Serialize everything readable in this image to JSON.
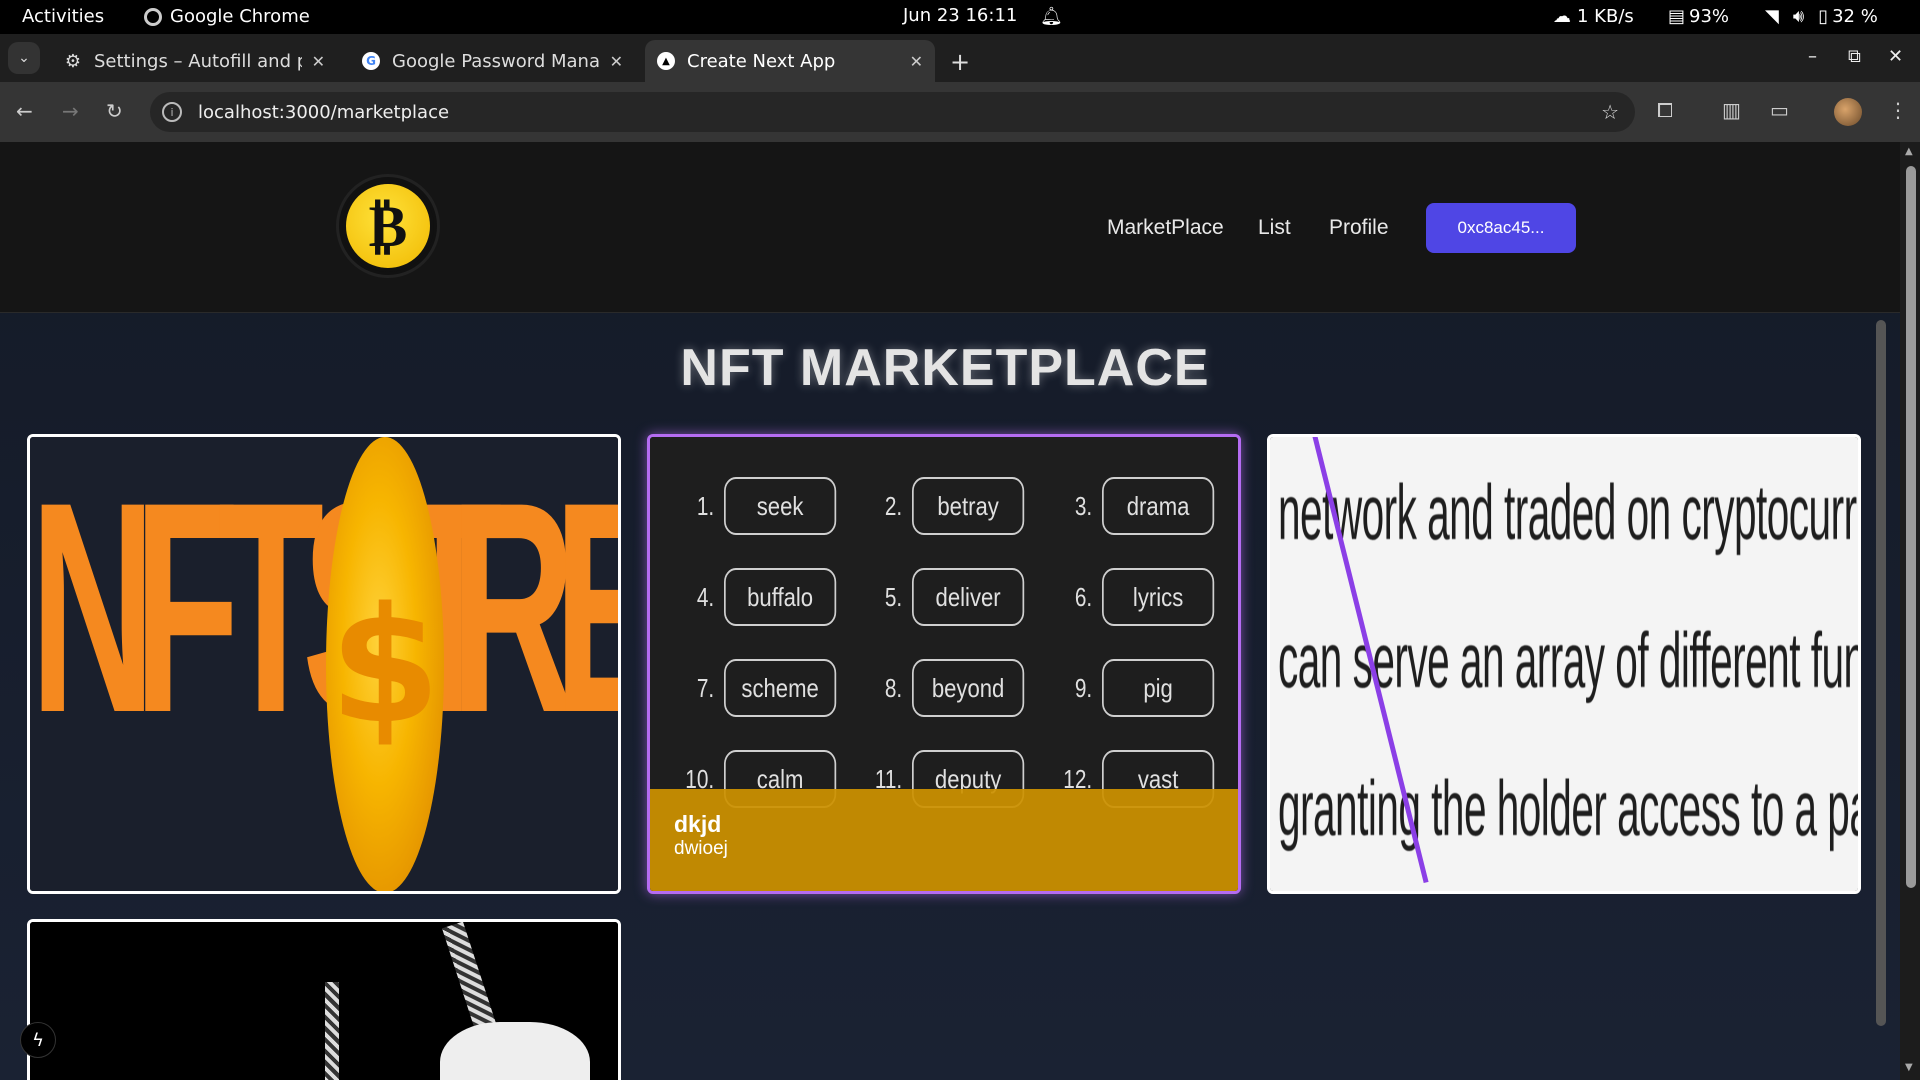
{
  "system_bar": {
    "activities": "Activities",
    "app_name": "Google Chrome",
    "datetime": "Jun 23  16:11",
    "network_speed": "1 KB/s",
    "memory": "93%",
    "battery": "32 %"
  },
  "browser": {
    "tabs": [
      {
        "title": "Settings – Autofill and pa",
        "icon": "gear-icon",
        "active": false
      },
      {
        "title": "Google Password Manag",
        "icon": "google-icon",
        "active": false
      },
      {
        "title": "Create Next App",
        "icon": "nextjs-icon",
        "active": true
      }
    ],
    "new_tab": "+",
    "url": "localhost:3000/marketplace"
  },
  "site": {
    "nav": {
      "marketplace": "MarketPlace",
      "list": "List",
      "profile": "Profile",
      "wallet_button": "0xc8ac45..."
    },
    "heading": "NFT MARKETPLACE",
    "cards": [
      {
        "image": "NFTSTORE logo art",
        "art_text": "NFTST",
        "art_text_end": "RE"
      },
      {
        "name": "dkjd",
        "description": "dwioej",
        "seed_words": [
          {
            "n": "1.",
            "w": "seek"
          },
          {
            "n": "2.",
            "w": "betray"
          },
          {
            "n": "3.",
            "w": "drama"
          },
          {
            "n": "4.",
            "w": "buffalo"
          },
          {
            "n": "5.",
            "w": "deliver"
          },
          {
            "n": "6.",
            "w": "lyrics"
          },
          {
            "n": "7.",
            "w": "scheme"
          },
          {
            "n": "8.",
            "w": "beyond"
          },
          {
            "n": "9.",
            "w": "pig"
          },
          {
            "n": "10.",
            "w": "calm"
          },
          {
            "n": "11.",
            "w": "deputy"
          },
          {
            "n": "12.",
            "w": "vast"
          }
        ]
      },
      {
        "text_lines": [
          "network and traded on cryptocurrency exchange",
          "can serve an array of different functions, from",
          "granting the holder access to a particular servic"
        ]
      },
      {
        "image": "black and white ninja art"
      }
    ]
  },
  "colors": {
    "accent": "#4f46e5",
    "overlay": "#cc9100",
    "hover_border": "#b56cf2"
  }
}
